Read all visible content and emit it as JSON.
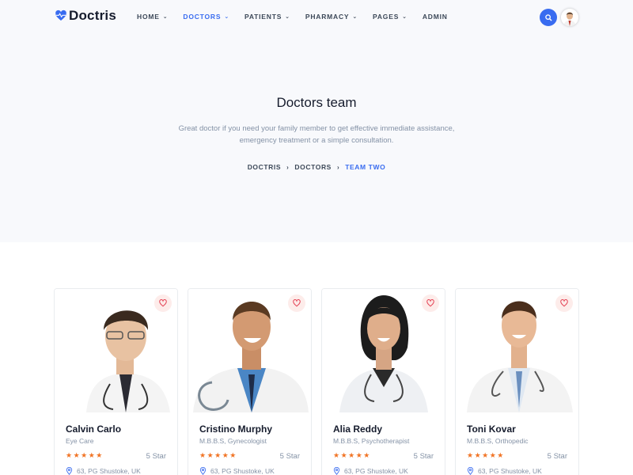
{
  "brand": {
    "name": "Doctris",
    "accent": "#396cf0"
  },
  "nav": {
    "items": [
      {
        "label": "HOME",
        "has_caret": true,
        "active": false
      },
      {
        "label": "DOCTORS",
        "has_caret": true,
        "active": true
      },
      {
        "label": "PATIENTS",
        "has_caret": true,
        "active": false
      },
      {
        "label": "PHARMACY",
        "has_caret": true,
        "active": false
      },
      {
        "label": "PAGES",
        "has_caret": true,
        "active": false
      },
      {
        "label": "ADMIN",
        "has_caret": false,
        "active": false
      }
    ],
    "search_icon": "search-icon",
    "avatar_icon": "user-avatar"
  },
  "hero": {
    "title": "Doctors team",
    "subtitle": "Great doctor if you need your family member to get effective immediate assistance, emergency treatment or a simple consultation.",
    "breadcrumb": [
      "DOCTRIS",
      "DOCTORS",
      "TEAM TWO"
    ]
  },
  "doctors": [
    {
      "name": "Calvin Carlo",
      "specialty": "Eye Care",
      "stars": "★★★★★",
      "rating": "5 Star",
      "location": "63, PG Shustoke, UK"
    },
    {
      "name": "Cristino Murphy",
      "specialty": "M.B.B.S, Gynecologist",
      "stars": "★★★★★",
      "rating": "5 Star",
      "location": "63, PG Shustoke, UK"
    },
    {
      "name": "Alia Reddy",
      "specialty": "M.B.B.S, Psychotherapist",
      "stars": "★★★★★",
      "rating": "5 Star",
      "location": "63, PG Shustoke, UK"
    },
    {
      "name": "Toni Kovar",
      "specialty": "M.B.B.S, Orthopedic",
      "stars": "★★★★★",
      "rating": "5 Star",
      "location": "63, PG Shustoke, UK"
    }
  ]
}
